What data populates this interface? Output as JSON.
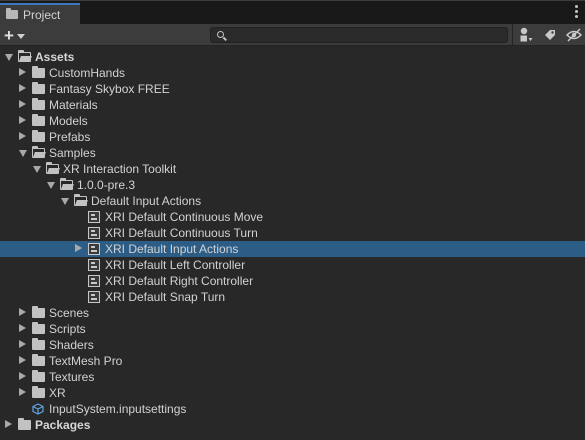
{
  "window": {
    "tab_title": "Project"
  },
  "toolbar": {
    "create_label": "+",
    "search_value": "",
    "search_placeholder": "",
    "icons": [
      "filter-by-type-icon",
      "filter-by-label-icon",
      "hidden-packages-icon"
    ]
  },
  "tree": {
    "rows": [
      {
        "label": "Assets",
        "depth": 0,
        "kind": "folder",
        "expanded": true,
        "bold": true
      },
      {
        "label": "CustomHands",
        "depth": 1,
        "kind": "folder",
        "expanded": false
      },
      {
        "label": "Fantasy Skybox FREE",
        "depth": 1,
        "kind": "folder",
        "expanded": false
      },
      {
        "label": "Materials",
        "depth": 1,
        "kind": "folder",
        "expanded": false
      },
      {
        "label": "Models",
        "depth": 1,
        "kind": "folder",
        "expanded": false
      },
      {
        "label": "Prefabs",
        "depth": 1,
        "kind": "folder",
        "expanded": false
      },
      {
        "label": "Samples",
        "depth": 1,
        "kind": "folder",
        "expanded": true
      },
      {
        "label": "XR Interaction Toolkit",
        "depth": 2,
        "kind": "folder",
        "expanded": true
      },
      {
        "label": "1.0.0-pre.3",
        "depth": 3,
        "kind": "folder",
        "expanded": true
      },
      {
        "label": "Default Input Actions",
        "depth": 4,
        "kind": "folder",
        "expanded": true
      },
      {
        "label": "XRI Default Continuous Move",
        "depth": 5,
        "kind": "asset"
      },
      {
        "label": "XRI Default Continuous Turn",
        "depth": 5,
        "kind": "asset"
      },
      {
        "label": "XRI Default Input Actions",
        "depth": 5,
        "kind": "input-actions",
        "expanded": false,
        "selected": true
      },
      {
        "label": "XRI Default Left Controller",
        "depth": 5,
        "kind": "asset"
      },
      {
        "label": "XRI Default Right Controller",
        "depth": 5,
        "kind": "asset"
      },
      {
        "label": "XRI Default Snap Turn",
        "depth": 5,
        "kind": "asset"
      },
      {
        "label": "Scenes",
        "depth": 1,
        "kind": "folder",
        "expanded": false
      },
      {
        "label": "Scripts",
        "depth": 1,
        "kind": "folder",
        "expanded": false
      },
      {
        "label": "Shaders",
        "depth": 1,
        "kind": "folder",
        "expanded": false
      },
      {
        "label": "TextMesh Pro",
        "depth": 1,
        "kind": "folder",
        "expanded": false
      },
      {
        "label": "Textures",
        "depth": 1,
        "kind": "folder",
        "expanded": false
      },
      {
        "label": "XR",
        "depth": 1,
        "kind": "folder",
        "expanded": false
      },
      {
        "label": "InputSystem.inputsettings",
        "depth": 1,
        "kind": "settings"
      },
      {
        "label": "Packages",
        "depth": 0,
        "kind": "folder",
        "expanded": false,
        "bold": true
      }
    ]
  },
  "colors": {
    "background": "#282828",
    "toolbar": "#3c3c3c",
    "selection": "#2c5d87",
    "tab_accent": "#3a79bb",
    "text": "#d2d2d2"
  }
}
